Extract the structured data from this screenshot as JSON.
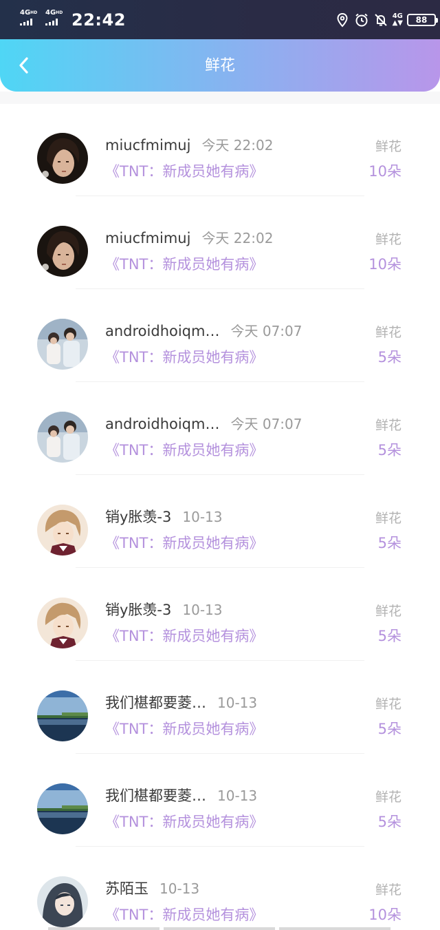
{
  "status_bar": {
    "net1": "4G",
    "net1_sup": "HD",
    "net2": "4G",
    "net2_sup": "HD",
    "time": "22:42",
    "net3": "4G",
    "battery": "88"
  },
  "header": {
    "title": "鲜花",
    "back_icon": "chevron-left-icon"
  },
  "colors": {
    "accent_purple": "#b491dd",
    "header_gradient_start": "#4fd6f5",
    "header_gradient_end": "#b896ea"
  },
  "records": [
    {
      "name": "miucfmimuj",
      "time": "今天 22:02",
      "book": "《TNT：新成员她有病》",
      "gift_label": "鲜花",
      "count": "10朵",
      "avatar": "dark-hair-boy"
    },
    {
      "name": "miucfmimuj",
      "time": "今天 22:02",
      "book": "《TNT：新成员她有病》",
      "gift_label": "鲜花",
      "count": "10朵",
      "avatar": "dark-hair-boy"
    },
    {
      "name": "androidhoiqm…",
      "time": "今天 07:07",
      "book": "《TNT：新成员她有病》",
      "gift_label": "鲜花",
      "count": "5朵",
      "avatar": "couple-photo"
    },
    {
      "name": "androidhoiqm…",
      "time": "今天 07:07",
      "book": "《TNT：新成员她有病》",
      "gift_label": "鲜花",
      "count": "5朵",
      "avatar": "couple-photo"
    },
    {
      "name": "销y胀羡-3",
      "time": "10-13",
      "book": "《TNT：新成员她有病》",
      "gift_label": "鲜花",
      "count": "5朵",
      "avatar": "anime-boy"
    },
    {
      "name": "销y胀羡-3",
      "time": "10-13",
      "book": "《TNT：新成员她有病》",
      "gift_label": "鲜花",
      "count": "5朵",
      "avatar": "anime-boy"
    },
    {
      "name": "我们椹都要菱…",
      "time": "10-13",
      "book": "《TNT：新成员她有病》",
      "gift_label": "鲜花",
      "count": "5朵",
      "avatar": "lake-landscape"
    },
    {
      "name": "我们椹都要菱…",
      "time": "10-13",
      "book": "《TNT：新成员她有病》",
      "gift_label": "鲜花",
      "count": "5朵",
      "avatar": "lake-landscape"
    },
    {
      "name": "苏陌玉",
      "time": "10-13",
      "book": "《TNT：新成员她有病》",
      "gift_label": "鲜花",
      "count": "10朵",
      "avatar": "anime-girl"
    }
  ]
}
